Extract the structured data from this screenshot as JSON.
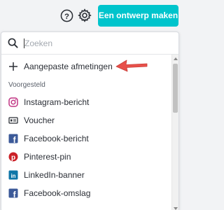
{
  "header": {
    "create_button_label": "Een ontwerp maken",
    "help_icon": "question-circle-icon",
    "settings_icon": "gear-icon"
  },
  "dropdown": {
    "search": {
      "placeholder": "Zoeken",
      "value": ""
    },
    "custom_size": {
      "label": "Aangepaste afmetingen",
      "icon": "plus-icon"
    },
    "section_label": "Voorgesteld",
    "items": [
      {
        "label": "Instagram-bericht",
        "icon": "instagram-icon"
      },
      {
        "label": "Voucher",
        "icon": "voucher-icon"
      },
      {
        "label": "Facebook-bericht",
        "icon": "facebook-icon"
      },
      {
        "label": "Pinterest-pin",
        "icon": "pinterest-icon"
      },
      {
        "label": "LinkedIn-banner",
        "icon": "linkedin-icon"
      },
      {
        "label": "Facebook-omslag",
        "icon": "facebook-icon"
      }
    ]
  },
  "colors": {
    "accent": "#00c4cc",
    "annotation_arrow": "#e8504a",
    "facebook": "#3b5998",
    "pinterest": "#cb2027",
    "linkedin": "#0e76a8",
    "instagram": "#c13584"
  }
}
